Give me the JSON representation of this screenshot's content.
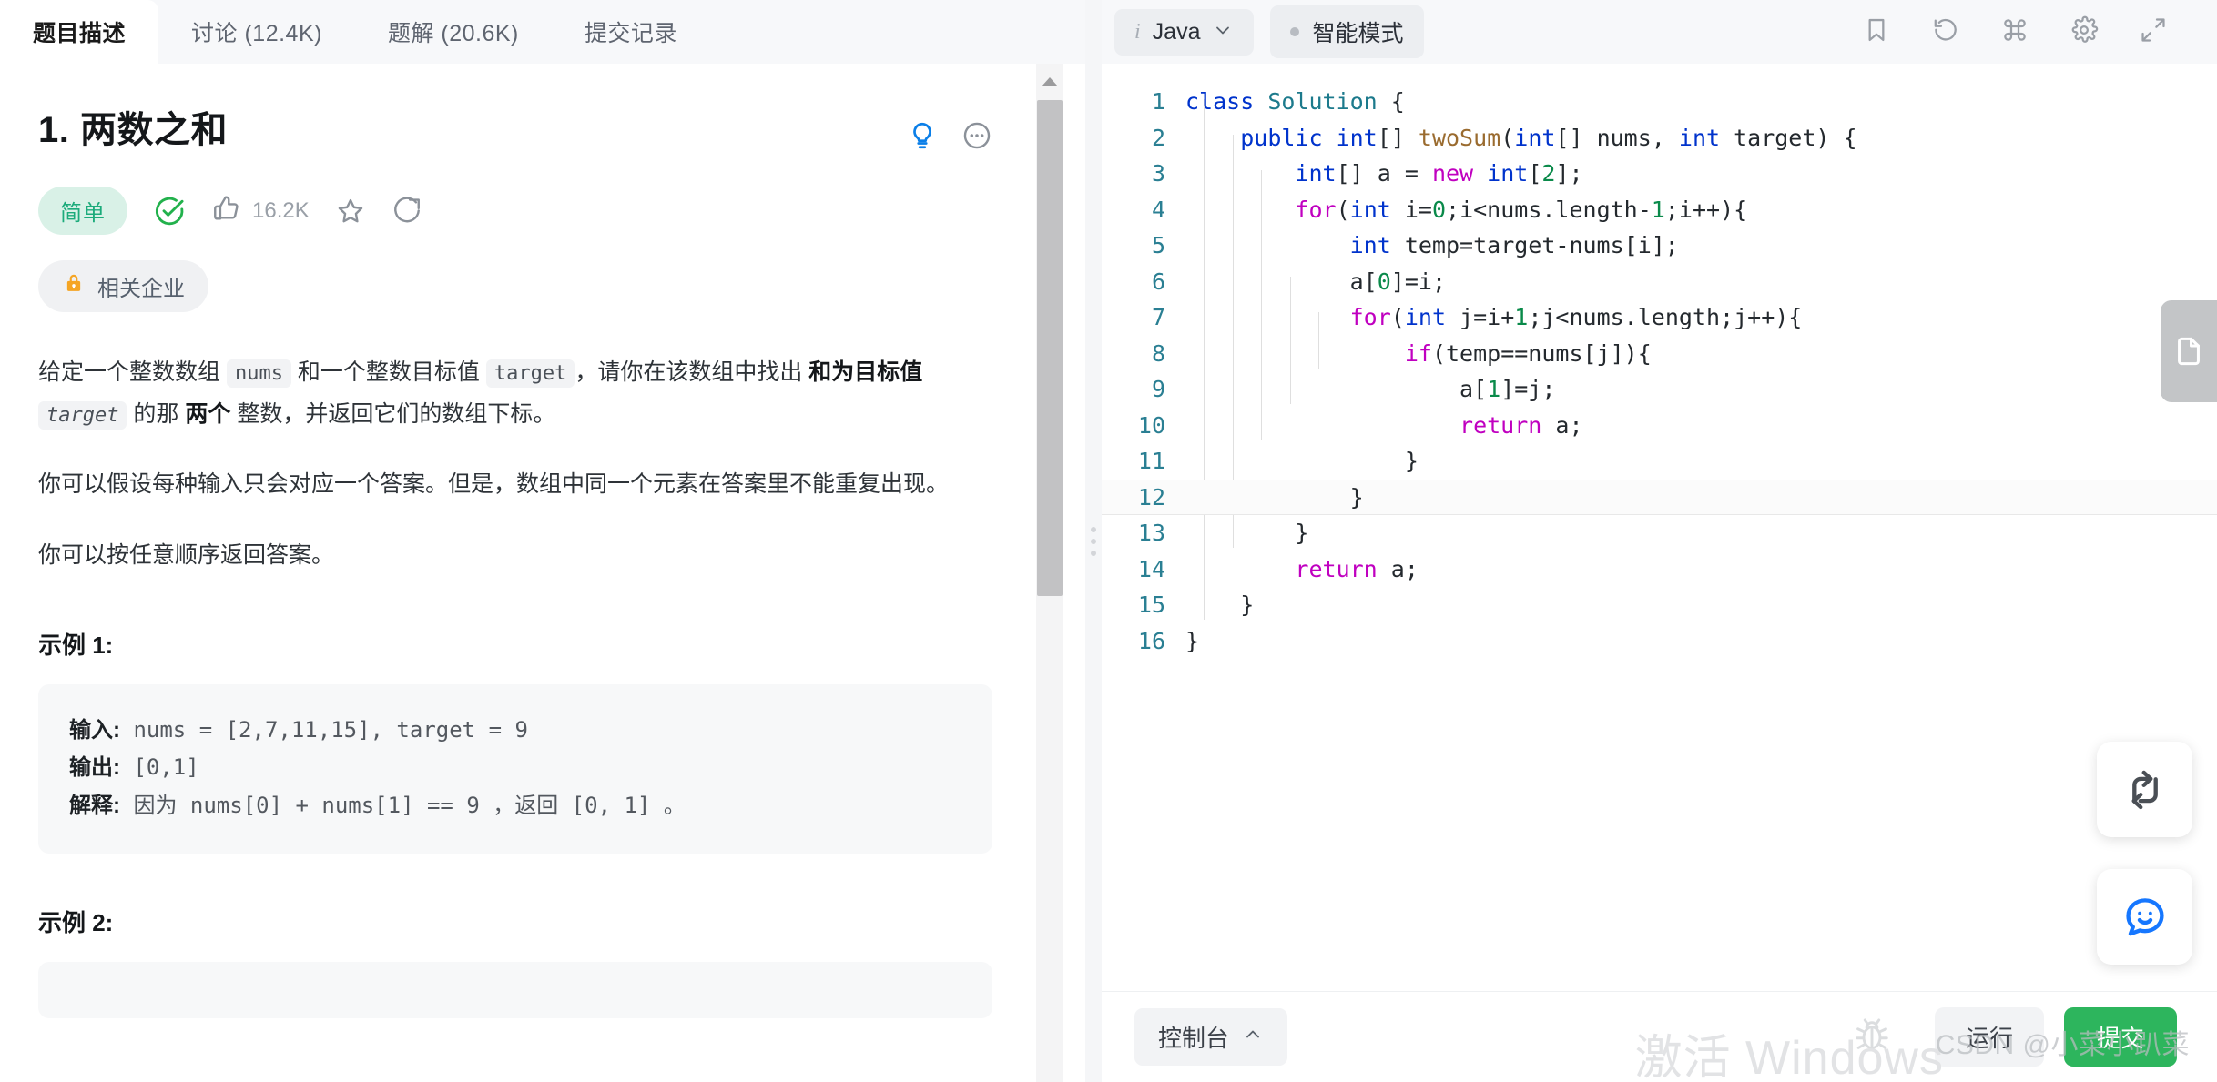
{
  "tabs": [
    {
      "label": "题目描述",
      "active": true
    },
    {
      "label": "讨论 (12.4K)",
      "active": false
    },
    {
      "label": "题解 (20.6K)",
      "active": false
    },
    {
      "label": "提交记录",
      "active": false
    }
  ],
  "problem": {
    "title": "1. 两数之和",
    "difficulty": "简单",
    "likes": "16.2K",
    "company_badge": "相关企业",
    "hint_icon": "lightbulb-icon",
    "more_icon": "more-options-icon",
    "solved_icon": "check-circle-icon",
    "like_icon": "thumbs-up-icon",
    "star_icon": "star-icon",
    "share_icon": "share-icon",
    "lock_icon": "lock-icon"
  },
  "description": {
    "p1_a": "给定一个整数数组 ",
    "p1_code1": "nums",
    "p1_b": " 和一个整数目标值 ",
    "p1_code2": "target",
    "p1_c": "，请你在该数组中找出 ",
    "p1_bold1": "和为目标值",
    "p1_code3": "target",
    "p1_d": " 的那 ",
    "p1_bold2": "两个",
    "p1_e": " 整数，并返回它们的数组下标。",
    "p2": "你可以假设每种输入只会对应一个答案。但是，数组中同一个元素在答案里不能重复出现。",
    "p3": "你可以按任意顺序返回答案。"
  },
  "examples": [
    {
      "heading": "示例 1:",
      "input_label": "输入:",
      "input_value": " nums = [2,7,11,15], target = 9",
      "output_label": "输出:",
      "output_value": " [0,1]",
      "explain_label": "解释:",
      "explain_value": " 因为 nums[0] + nums[1] == 9 ，返回 [0, 1] 。"
    },
    {
      "heading": "示例 2:"
    }
  ],
  "editor": {
    "language": "Java",
    "language_info_icon": "info-icon",
    "language_chevron_icon": "chevron-down-icon",
    "smart_mode": "智能模式",
    "topbar_icons": [
      {
        "name": "bookmark-icon"
      },
      {
        "name": "reset-icon"
      },
      {
        "name": "shortcuts-icon"
      },
      {
        "name": "settings-gear-icon"
      },
      {
        "name": "fullscreen-icon"
      }
    ],
    "current_line": 12,
    "lines": [
      {
        "n": "1",
        "indent": 0,
        "tokens": [
          {
            "t": "class ",
            "c": "k"
          },
          {
            "t": "Solution",
            "c": "cn"
          },
          {
            "t": " {",
            "c": "pl"
          }
        ]
      },
      {
        "n": "2",
        "indent": 1,
        "tokens": [
          {
            "t": "public ",
            "c": "k"
          },
          {
            "t": "int",
            "c": "k"
          },
          {
            "t": "[] ",
            "c": "pl"
          },
          {
            "t": "twoSum",
            "c": "fn"
          },
          {
            "t": "(",
            "c": "pl"
          },
          {
            "t": "int",
            "c": "k"
          },
          {
            "t": "[] nums, ",
            "c": "pl"
          },
          {
            "t": "int",
            "c": "k"
          },
          {
            "t": " target) {",
            "c": "pl"
          }
        ]
      },
      {
        "n": "3",
        "indent": 2,
        "tokens": [
          {
            "t": "int",
            "c": "k"
          },
          {
            "t": "[] a = ",
            "c": "pl"
          },
          {
            "t": "new ",
            "c": "kw"
          },
          {
            "t": "int",
            "c": "k"
          },
          {
            "t": "[",
            "c": "pl"
          },
          {
            "t": "2",
            "c": "num"
          },
          {
            "t": "];",
            "c": "pl"
          }
        ]
      },
      {
        "n": "4",
        "indent": 2,
        "tokens": [
          {
            "t": "for",
            "c": "kw"
          },
          {
            "t": "(",
            "c": "pl"
          },
          {
            "t": "int",
            "c": "k"
          },
          {
            "t": " i=",
            "c": "pl"
          },
          {
            "t": "0",
            "c": "num"
          },
          {
            "t": ";i<nums.length-",
            "c": "pl"
          },
          {
            "t": "1",
            "c": "num"
          },
          {
            "t": ";i++){",
            "c": "pl"
          }
        ]
      },
      {
        "n": "5",
        "indent": 3,
        "tokens": [
          {
            "t": "int",
            "c": "k"
          },
          {
            "t": " temp=target-nums[i];",
            "c": "pl"
          }
        ]
      },
      {
        "n": "6",
        "indent": 3,
        "tokens": [
          {
            "t": "a[",
            "c": "pl"
          },
          {
            "t": "0",
            "c": "num"
          },
          {
            "t": "]=i;",
            "c": "pl"
          }
        ]
      },
      {
        "n": "7",
        "indent": 3,
        "tokens": [
          {
            "t": "for",
            "c": "kw"
          },
          {
            "t": "(",
            "c": "pl"
          },
          {
            "t": "int",
            "c": "k"
          },
          {
            "t": " j=i+",
            "c": "pl"
          },
          {
            "t": "1",
            "c": "num"
          },
          {
            "t": ";j<nums.length;j++){",
            "c": "pl"
          }
        ]
      },
      {
        "n": "8",
        "indent": 4,
        "tokens": [
          {
            "t": "if",
            "c": "kw"
          },
          {
            "t": "(temp==nums[j]){",
            "c": "pl"
          }
        ]
      },
      {
        "n": "9",
        "indent": 5,
        "tokens": [
          {
            "t": "a[",
            "c": "pl"
          },
          {
            "t": "1",
            "c": "num"
          },
          {
            "t": "]=j;",
            "c": "pl"
          }
        ]
      },
      {
        "n": "10",
        "indent": 5,
        "tokens": [
          {
            "t": "return",
            "c": "kw"
          },
          {
            "t": " a;",
            "c": "pl"
          }
        ]
      },
      {
        "n": "11",
        "indent": 4,
        "tokens": [
          {
            "t": "}",
            "c": "pl"
          }
        ]
      },
      {
        "n": "12",
        "indent": 3,
        "tokens": [
          {
            "t": "}",
            "c": "pl"
          }
        ]
      },
      {
        "n": "13",
        "indent": 2,
        "tokens": [
          {
            "t": "}",
            "c": "pl"
          }
        ]
      },
      {
        "n": "14",
        "indent": 2,
        "tokens": [
          {
            "t": "return",
            "c": "kw"
          },
          {
            "t": " a;",
            "c": "pl"
          }
        ]
      },
      {
        "n": "15",
        "indent": 1,
        "tokens": [
          {
            "t": "}",
            "c": "pl"
          }
        ]
      },
      {
        "n": "16",
        "indent": 0,
        "tokens": [
          {
            "t": "}",
            "c": "pl"
          }
        ]
      }
    ]
  },
  "side_buttons": {
    "note_icon": "note-document-icon",
    "swap_icon": "swap-arrows-icon",
    "chat_icon": "chat-smiley-icon"
  },
  "bottom": {
    "console_label": "控制台",
    "console_chevron_icon": "chevron-up-icon",
    "bug_icon": "bug-icon",
    "run_label": "运行",
    "submit_label": "提交"
  },
  "watermarks": {
    "csdn": "CSDN @小菜小趴菜",
    "windows": "激活 Windows"
  },
  "colors": {
    "accent_green": "#2db55d",
    "difficulty_bg": "#d9f1e7",
    "difficulty_text": "#1cab7b",
    "hint_blue": "#0b7fe8",
    "chat_blue": "#1677ff",
    "lock_orange": "#f5a524"
  }
}
